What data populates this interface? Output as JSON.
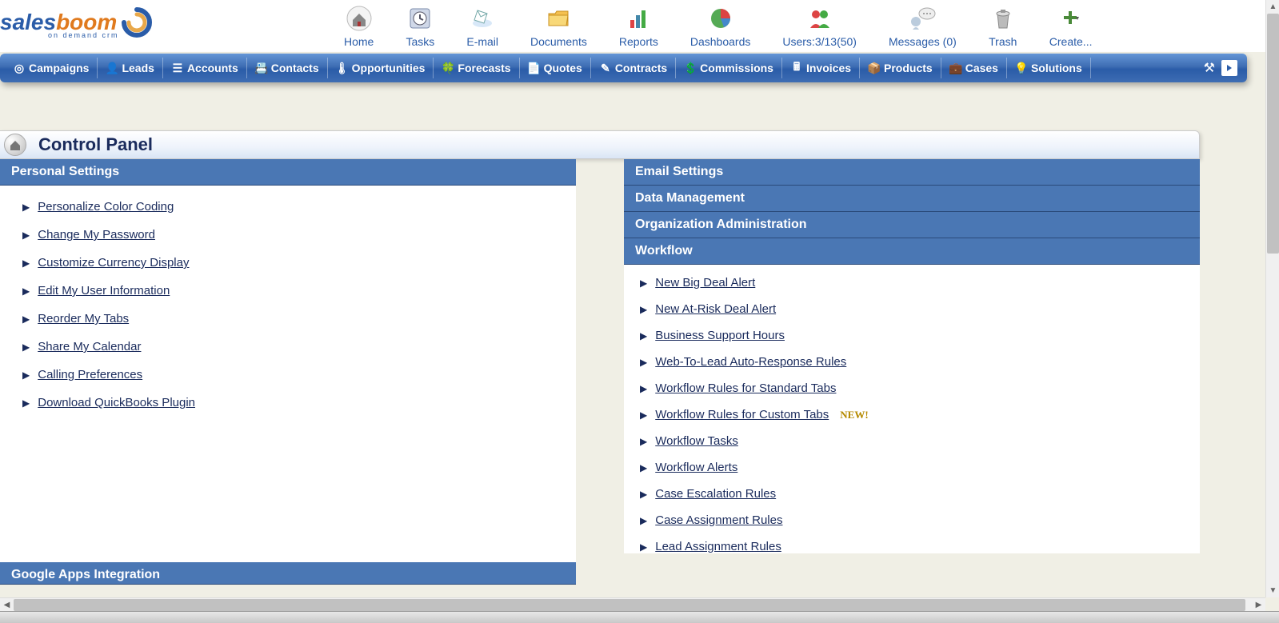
{
  "logo": {
    "text_a": "sales",
    "text_b": "boom",
    "sub": "on demand crm"
  },
  "topToolbar": [
    {
      "label": "Home",
      "icon": "home-icon"
    },
    {
      "label": "Tasks",
      "icon": "clock-icon"
    },
    {
      "label": "E-mail",
      "icon": "mail-icon"
    },
    {
      "label": "Documents",
      "icon": "folder-icon"
    },
    {
      "label": "Reports",
      "icon": "chart-icon"
    },
    {
      "label": "Dashboards",
      "icon": "pie-icon"
    },
    {
      "label": "Users:3/13(50)",
      "icon": "users-icon"
    },
    {
      "label": "Messages (0)",
      "icon": "chat-icon"
    },
    {
      "label": "Trash",
      "icon": "trash-icon"
    },
    {
      "label": "Create...",
      "icon": "plus-icon"
    }
  ],
  "navItems": [
    "Campaigns",
    "Leads",
    "Accounts",
    "Contacts",
    "Opportunities",
    "Forecasts",
    "Quotes",
    "Contracts",
    "Commissions",
    "Invoices",
    "Products",
    "Cases",
    "Solutions"
  ],
  "pageTitle": "Control Panel",
  "leftSections": [
    {
      "title": "Personal Settings",
      "links": [
        "Personalize Color Coding",
        "Change My Password",
        "Customize Currency Display",
        "Edit My User Information",
        "Reorder My Tabs",
        "Share My Calendar",
        "Calling Preferences",
        "Download QuickBooks Plugin"
      ]
    }
  ],
  "leftBottomSection": {
    "title": "Google Apps Integration"
  },
  "rightCollapsed": [
    "Email Settings",
    "Data Management",
    "Organization Administration"
  ],
  "rightOpen": {
    "title": "Workflow",
    "links": [
      {
        "text": "New Big Deal Alert"
      },
      {
        "text": "New At-Risk Deal Alert"
      },
      {
        "text": "Business Support Hours"
      },
      {
        "text": "Web-To-Lead Auto-Response Rules"
      },
      {
        "text": "Workflow Rules for Standard Tabs"
      },
      {
        "text": "Workflow Rules for Custom Tabs",
        "new": true
      },
      {
        "text": "Workflow Tasks"
      },
      {
        "text": "Workflow Alerts"
      },
      {
        "text": "Case Escalation Rules"
      },
      {
        "text": "Case Assignment Rules"
      },
      {
        "text": "Lead Assignment Rules"
      }
    ]
  },
  "newBadge": "NEW!"
}
